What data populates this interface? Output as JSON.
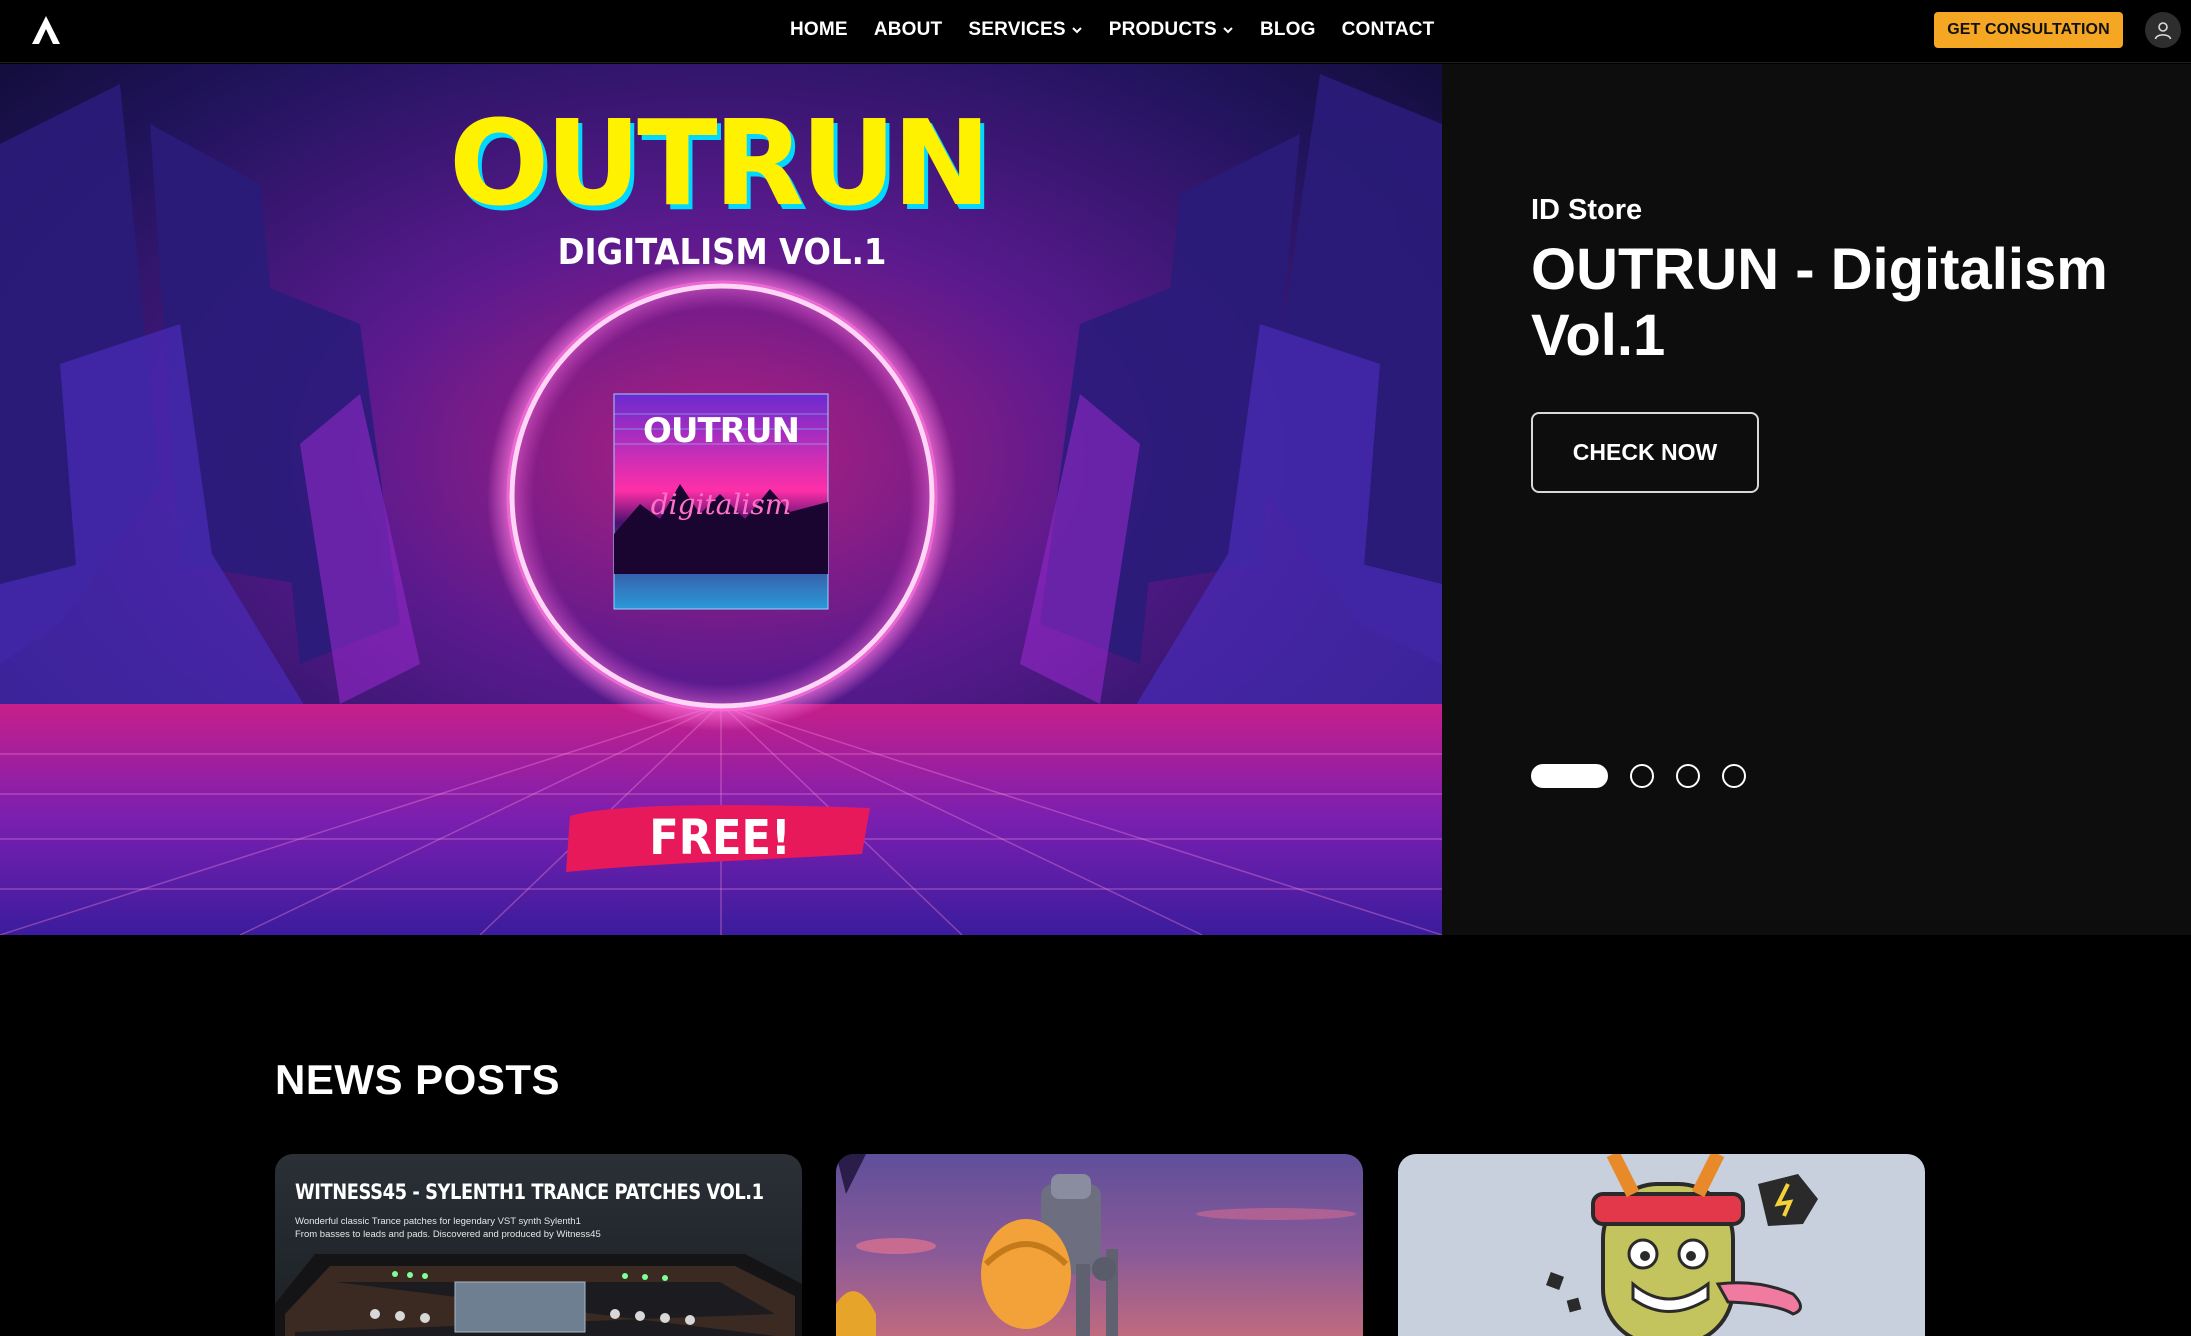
{
  "nav": {
    "items": [
      {
        "label": "HOME"
      },
      {
        "label": "ABOUT"
      },
      {
        "label": "SERVICES"
      },
      {
        "label": "PRODUCTS"
      },
      {
        "label": "BLOG"
      },
      {
        "label": "CONTACT"
      }
    ],
    "cta_label": "GET CONSULTATION"
  },
  "hero": {
    "art": {
      "headline": "OUTRUN",
      "subheadline": "DIGITALISM VOL.1",
      "cover_title": "OUTRUN",
      "cover_script": "digitalism",
      "badge": "FREE!"
    },
    "store_label": "ID Store",
    "title_line1": "OUTRUN - Digitalism",
    "title_line2": "Vol.1",
    "button_label": "CHECK NOW",
    "slides_total": 4,
    "active_slide": 1
  },
  "news": {
    "heading": "NEWS POSTS",
    "cards": [
      {
        "title": "WITNESS45 - SYLENTH1 TRANCE PATCHES VOL.1",
        "desc_line1": "Wonderful classic Trance patches for legendary VST synth Sylenth1",
        "desc_line2": "From basses to leads and pads. Discovered and produced by Witness45"
      },
      {},
      {}
    ]
  },
  "colors": {
    "accent": "#f5a623",
    "headline_yellow": "#fff200",
    "badge_pink": "#e8195a"
  }
}
